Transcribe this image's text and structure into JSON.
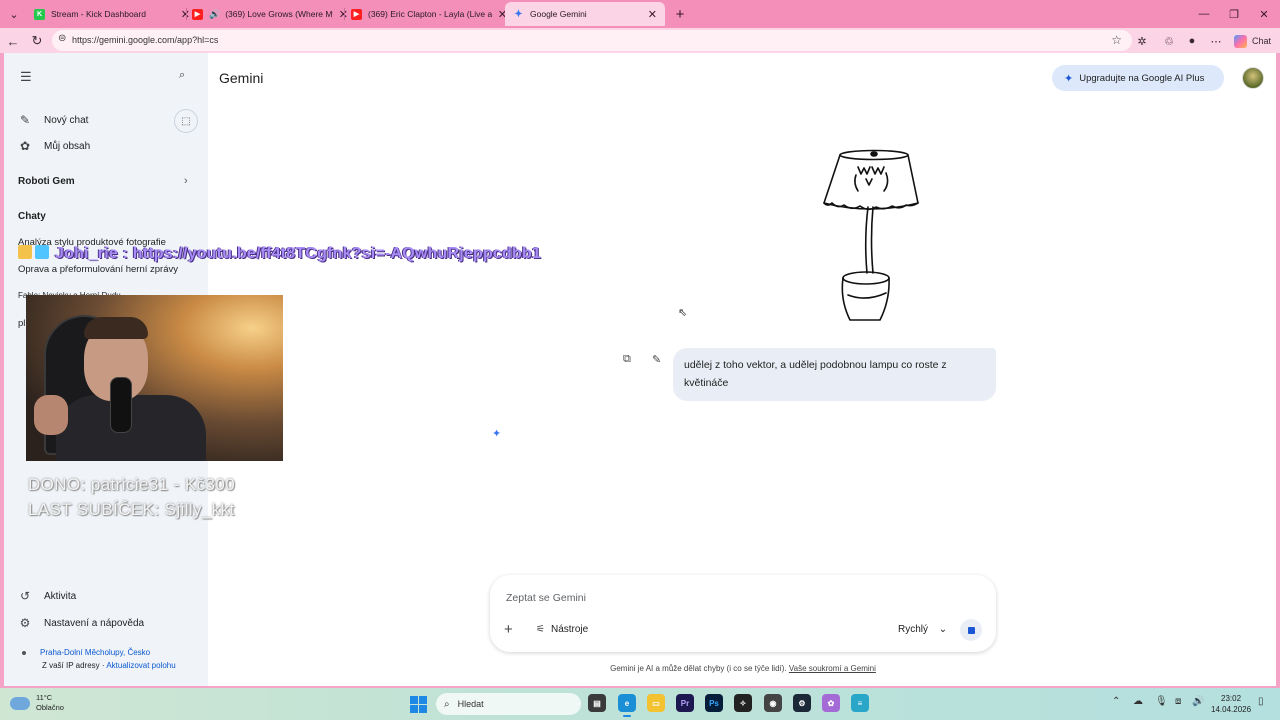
{
  "browser": {
    "tabs": [
      {
        "title": "Stream - Kick Dashboard",
        "favicon_color": "#25c94d",
        "favicon_char": "K",
        "audio": false,
        "active": false
      },
      {
        "title": "(369) Love Grows (Where My",
        "favicon_color": "#ff1f1f",
        "favicon_char": "▶",
        "audio": true,
        "active": false
      },
      {
        "title": "(369) Eric Clapton - Layla (Live at",
        "favicon_color": "#ff1f1f",
        "favicon_char": "▶",
        "audio": false,
        "active": false
      },
      {
        "title": "Google Gemini",
        "favicon_color": "#ffffff",
        "favicon_char": "✦",
        "audio": false,
        "active": true
      }
    ],
    "url": "https://gemini.google.com/app?hl=cs",
    "chat_label": "Chat"
  },
  "sidebar": {
    "new_chat": "Nový chat",
    "my_content": "Můj obsah",
    "gems": "Roboti Gem",
    "chats_heading": "Chaty",
    "chats": [
      "Analýza stylu produktové fotografie",
      "Oprava a přeformulování herní zprávy",
      "Fable: Novinky o Herní Dudu",
      "pl"
    ],
    "activity": "Aktivita",
    "settings": "Nastavení a nápověda",
    "location": "Praha-Dolní Měcholupy, Česko",
    "location_source": "Z vaší IP adresy",
    "update_location": "Aktualizovat polohu"
  },
  "main": {
    "title": "Gemini",
    "upgrade": "Upgradujte na Google AI Plus",
    "user_message": "udělej z toho vektor, a udělej podobnou lampu co roste z květináče",
    "input_placeholder": "Zeptat se Gemini",
    "tools": "Nástroje",
    "mode": "Rychlý",
    "disclaimer": "Gemini je AI a může dělat chyby (i co se týče lidí).",
    "privacy_link": "Vaše soukromí a Gemini"
  },
  "overlay": {
    "link_text": "Johi_rie : https://youtu.be/ff4t8TCgfnk?si=-AQwhuRjeppcdbb1",
    "donation": "DONO: patricie31 - Kč300",
    "last_sub": "LAST SUBÍČEK: Sjilly_kkt"
  },
  "taskbar": {
    "temperature": "11°C",
    "condition": "Oblačno",
    "search": "Hledat",
    "time": "23:02",
    "date": "14.04.2026"
  },
  "colors": {
    "accent": "#1a56d6",
    "browser_frame": "#f48fba",
    "sidebar_bg": "#f0f4f9",
    "bubble_bg": "#e9eef6"
  }
}
